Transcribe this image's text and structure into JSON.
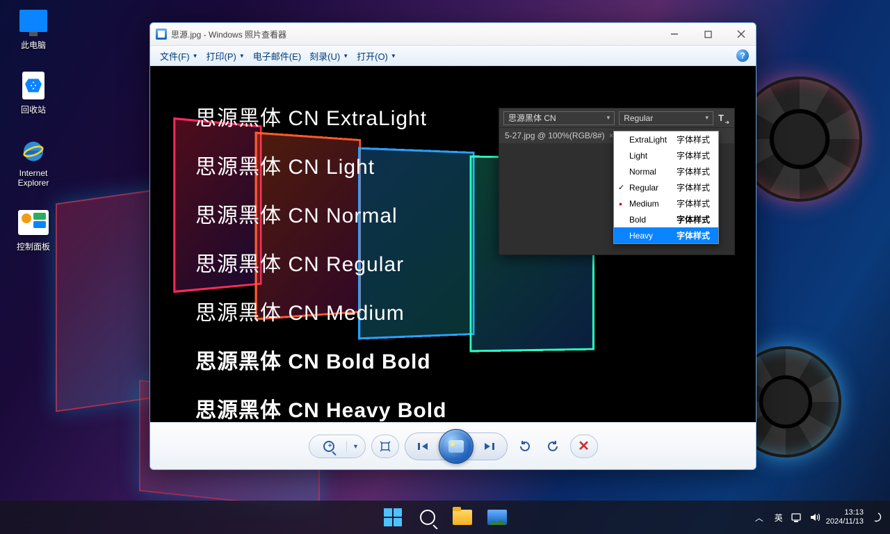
{
  "desktop_icons": [
    {
      "label": "此电脑"
    },
    {
      "label": "回收站"
    },
    {
      "label": "Internet\nExplorer"
    },
    {
      "label": "控制面板"
    }
  ],
  "window": {
    "title": "思源.jpg - Windows 照片查看器",
    "menus": [
      "文件(F)",
      "打印(P)",
      "电子邮件(E)",
      "刻录(U)",
      "打开(O)"
    ]
  },
  "image": {
    "font_samples": [
      {
        "text": "思源黑体 CN ExtraLight",
        "weight": "200"
      },
      {
        "text": "思源黑体 CN Light",
        "weight": "300"
      },
      {
        "text": "思源黑体 CN Normal",
        "weight": "350"
      },
      {
        "text": "思源黑体 CN Regular",
        "weight": "400"
      },
      {
        "text": "思源黑体 CN Medium",
        "weight": "500"
      },
      {
        "text": "思源黑体 CN Bold Bold",
        "weight": "700"
      },
      {
        "text": "思源黑体 CN Heavy Bold",
        "weight": "900"
      }
    ],
    "ps": {
      "family": "思源黑体 CN",
      "weight_selected": "Regular",
      "tab": "5-27.jpg @ 100%(RGB/8#)",
      "weights": [
        {
          "name": "ExtraLight",
          "label": "字体样式",
          "w": "200"
        },
        {
          "name": "Light",
          "label": "字体样式",
          "w": "300"
        },
        {
          "name": "Normal",
          "label": "字体样式",
          "w": "350"
        },
        {
          "name": "Regular",
          "label": "字体样式",
          "w": "400",
          "checked": true
        },
        {
          "name": "Medium",
          "label": "字体样式",
          "w": "500",
          "dot": true
        },
        {
          "name": "Bold",
          "label": "字体样式",
          "w": "700"
        },
        {
          "name": "Heavy",
          "label": "字体样式",
          "w": "900",
          "selected": true
        }
      ]
    }
  },
  "tray": {
    "ime": "英",
    "time": "13:13",
    "date": "2024/11/13"
  }
}
